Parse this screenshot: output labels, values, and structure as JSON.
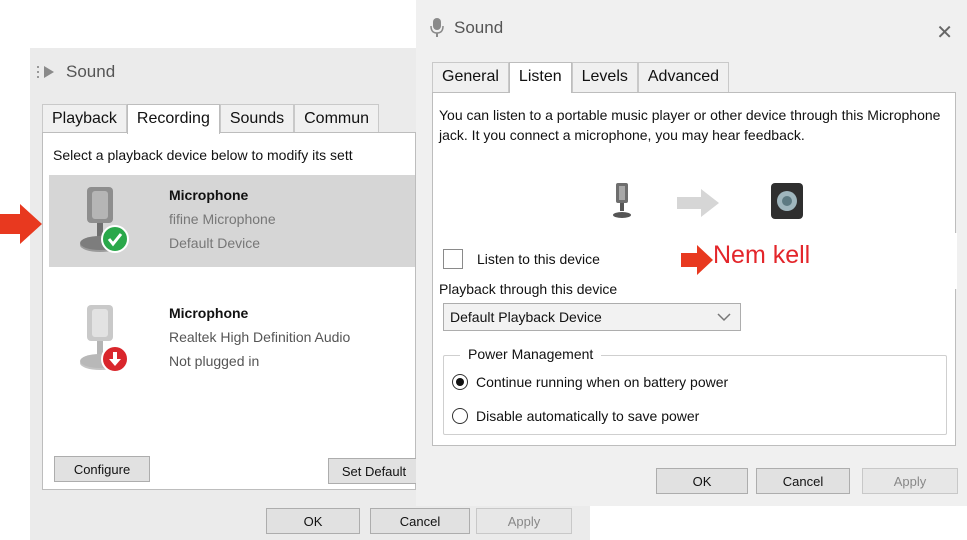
{
  "recording_dialog": {
    "title": "Sound",
    "tabs": [
      "Playback",
      "Recording",
      "Sounds",
      "Commun"
    ],
    "instruction": "Select a playback device below to modify its sett",
    "devices": [
      {
        "name": "Microphone",
        "line1": "fifine Microphone",
        "line2": "Default Device",
        "status": "default"
      },
      {
        "name": "Microphone",
        "line1": "Realtek High Definition Audio",
        "line2": "Not plugged in",
        "status": "unplugged"
      }
    ],
    "configure_label": "Configure",
    "set_default_label": "Set Default",
    "ok_label": "OK",
    "cancel_label": "Cancel",
    "apply_label": "Apply"
  },
  "listen_dialog": {
    "title": "Sound",
    "close_glyph": "✕",
    "tabs": [
      "General",
      "Listen",
      "Levels",
      "Advanced"
    ],
    "description": "You can listen to a portable music player or other device through this Microphone jack. It you connect a microphone, you may hear feedback.",
    "listen_checkbox_label": "Listen to this device",
    "listen_checked": false,
    "annotation": "Nem kell",
    "playback_label": "Playback through this device",
    "playback_value": "Default Playback Device",
    "power_group_label": "Power Management",
    "power_options": [
      {
        "label": "Continue running when on battery power",
        "selected": true
      },
      {
        "label": "Disable automatically to save power",
        "selected": false
      }
    ],
    "ok_label": "OK",
    "cancel_label": "Cancel",
    "apply_label": "Apply"
  },
  "colors": {
    "annotation_red": "#e3262b",
    "arrow_red": "#e8391f",
    "check_green": "#2aa84a",
    "unplugged_red": "#d9262c",
    "selected_row": "#d6d6d6"
  }
}
